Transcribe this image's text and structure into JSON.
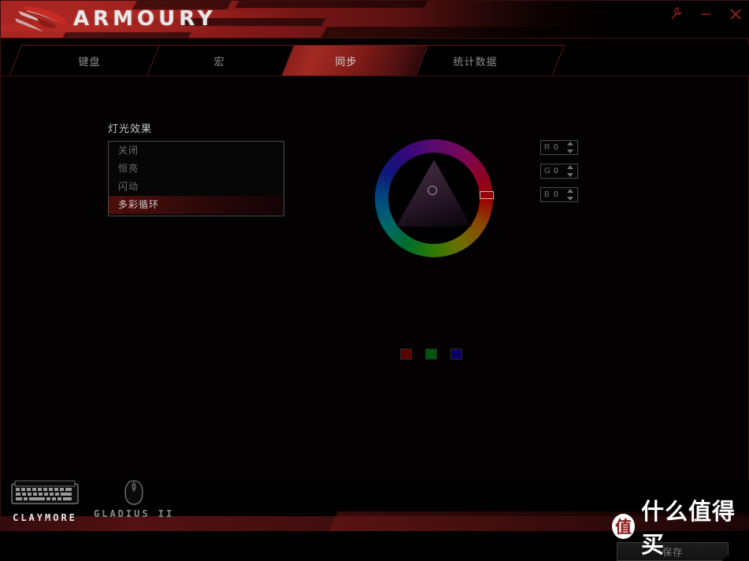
{
  "window": {
    "brand": "ARMOURY",
    "logo_icon": "rog-eye-logo",
    "controls": [
      {
        "name": "settings-wrench-button",
        "icon": "wrench-icon",
        "label": ""
      },
      {
        "name": "minimize-button",
        "icon": "minimize-icon",
        "label": ""
      },
      {
        "name": "close-button",
        "icon": "close-icon",
        "label": ""
      }
    ]
  },
  "tabs": [
    {
      "label": "键盘",
      "active": false
    },
    {
      "label": "宏",
      "active": false
    },
    {
      "label": "同步",
      "active": true
    },
    {
      "label": "统计数据",
      "active": false
    }
  ],
  "main": {
    "lighting_label": "灯光效果",
    "lighting_effects": [
      {
        "label": "关闭",
        "selected": false
      },
      {
        "label": "恒亮",
        "selected": false
      },
      {
        "label": "闪动",
        "selected": false
      },
      {
        "label": "多彩循环",
        "selected": true
      }
    ],
    "color_picker": {
      "icon": "color-wheel-icon",
      "triangle_cursor_icon": "saturation-cursor-icon",
      "hue_cursor_icon": "hue-cursor-icon"
    },
    "swatches": [
      {
        "name": "swatch-red",
        "color": "#5a0000"
      },
      {
        "name": "swatch-green",
        "color": "#00550a"
      },
      {
        "name": "swatch-blue",
        "color": "#0a0063"
      }
    ],
    "rgb": [
      {
        "channel": "R",
        "value": "0"
      },
      {
        "channel": "G",
        "value": "0"
      },
      {
        "channel": "B",
        "value": "0"
      }
    ],
    "save_label": "保存"
  },
  "footer": {
    "devices": [
      {
        "name": "CLAYMORE",
        "icon": "keyboard-icon",
        "active": true
      },
      {
        "name": "GLADIUS II",
        "icon": "mouse-icon",
        "active": false
      }
    ]
  },
  "watermark": {
    "badge": "值",
    "text": "什么值得买"
  },
  "colors": {
    "accent_red": "#a32a23",
    "border_red": "#61171b",
    "panel_black": "#030102"
  }
}
